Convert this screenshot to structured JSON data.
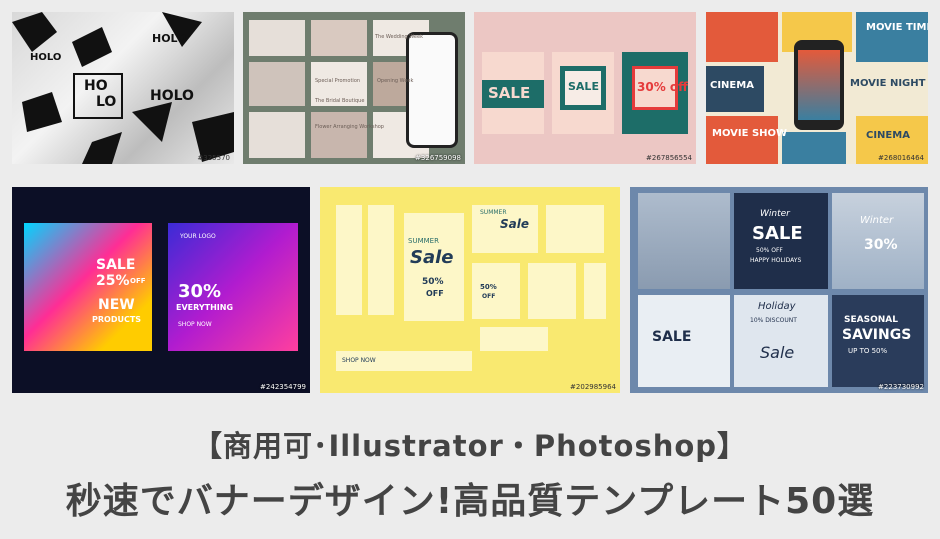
{
  "thumbnails": [
    {
      "id": "#325570",
      "labels": [
        "HOLO",
        "HOLO",
        "HO",
        "LO",
        "HOLO"
      ]
    },
    {
      "id": "#326759098",
      "labels": [
        "The Wedding Week",
        "Special Promotion",
        "The Bridal Boutique",
        "Flower Arranging Workshop",
        "Opening Week"
      ]
    },
    {
      "id": "#267856554",
      "labels": [
        "SALE",
        "30% off",
        "SALE"
      ]
    },
    {
      "id": "#268016464",
      "labels": [
        "CINEMA",
        "MOVIE NIGHT",
        "MOVIE TIME",
        "CINEMA",
        "MOVIE SHOW"
      ]
    },
    {
      "id": "#242354799",
      "labels": [
        "SALE",
        "25%",
        "OFF",
        "NEW",
        "PRODUCTS",
        "YOUR LOGO",
        "30%",
        "EVERYTHING",
        "SHOP NOW"
      ]
    },
    {
      "id": "#202985964",
      "labels": [
        "SUMMER",
        "Sale",
        "50%",
        "OFF",
        "SUMMER",
        "Sale",
        "50%",
        "OFF",
        "SHOP NOW"
      ]
    },
    {
      "id": "#223730992",
      "labels": [
        "Winter",
        "SALE",
        "50% OFF",
        "HAPPY HOLIDAYS",
        "Winter",
        "30%",
        "SALE",
        "Holiday",
        "10% DISCOUNT",
        "Sale",
        "SEASONAL",
        "SAVINGS",
        "UP TO 50%"
      ]
    }
  ],
  "caption": {
    "line1": "【商用可･Illustrator・Photoshop】",
    "line2": "秒速でバナーデザイン!高品質テンプレート50選"
  }
}
